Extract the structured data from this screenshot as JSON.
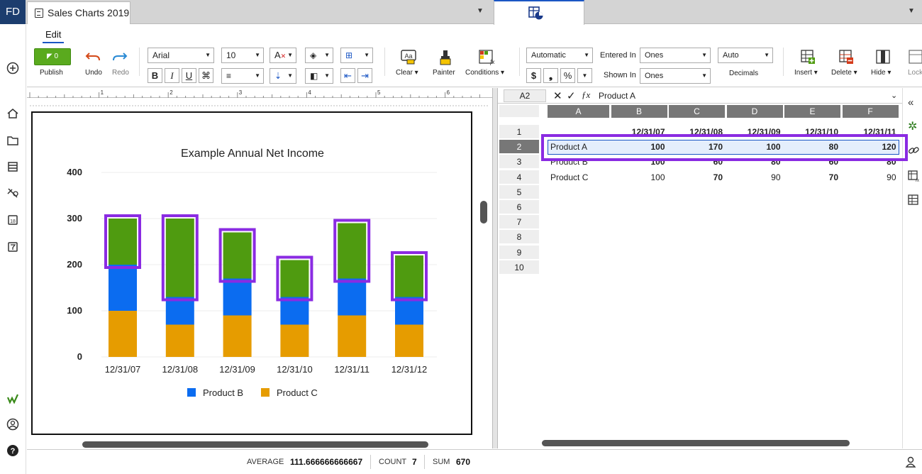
{
  "app": {
    "logo": "FD",
    "doc_tab": "Sales Charts 2019"
  },
  "toolbar": {
    "edit_tab": "Edit",
    "publish": {
      "badge": "0",
      "label": "Publish"
    },
    "undo": "Undo",
    "redo": "Redo",
    "font_family": "Arial",
    "font_size": "10",
    "bold": "B",
    "italic": "I",
    "underline": "U",
    "clear": "Clear",
    "painter": "Painter",
    "conditions": "Conditions",
    "number_format": "Automatic",
    "currency": "$",
    "comma": ")",
    "percent": "%",
    "entered_in_label": "Entered In",
    "entered_in_value": "Ones",
    "shown_in_label": "Shown In",
    "shown_in_value": "Ones",
    "decimals_value": "Auto",
    "decimals_label": "Decimals",
    "insert": "Insert",
    "delete": "Delete",
    "hide": "Hide",
    "lock": "Lock"
  },
  "ruler": [
    "1",
    "2",
    "3",
    "4",
    "5",
    "6"
  ],
  "chart_data": {
    "type": "bar",
    "stacked": true,
    "title": "Example Annual Net Income",
    "categories": [
      "12/31/07",
      "12/31/08",
      "12/31/09",
      "12/31/10",
      "12/31/11",
      "12/31/12"
    ],
    "ylim": [
      0,
      400
    ],
    "yticks": [
      "0",
      "100",
      "200",
      "300",
      "400"
    ],
    "series": [
      {
        "name": "Product C",
        "color": "#e69c00",
        "values": [
          100,
          70,
          90,
          70,
          90,
          70
        ]
      },
      {
        "name": "Product B",
        "color": "#0b6cf0",
        "values": [
          100,
          60,
          80,
          60,
          80,
          60
        ]
      },
      {
        "name": "",
        "color": "#4f9b10",
        "values": [
          100,
          170,
          100,
          80,
          120,
          90
        ]
      }
    ],
    "legend": [
      "Product B",
      "Product C"
    ],
    "legend_placement": "bottom"
  },
  "formula": {
    "cell_ref": "A2",
    "content": "Product A"
  },
  "sheet": {
    "columns": [
      "A",
      "B",
      "C",
      "D",
      "E",
      "F"
    ],
    "rows": [
      "1",
      "2",
      "3",
      "4",
      "5",
      "6",
      "7",
      "8",
      "9",
      "10"
    ],
    "header_row": [
      "",
      "12/31/07",
      "12/31/08",
      "12/31/09",
      "12/31/10",
      "12/31/11"
    ],
    "data": [
      [
        "Product A",
        "100",
        "170",
        "100",
        "80",
        "120"
      ],
      [
        "Product B",
        "100",
        "60",
        "80",
        "60",
        "80"
      ],
      [
        "Product C",
        "100",
        "70",
        "90",
        "70",
        "90"
      ]
    ]
  },
  "status": {
    "average_label": "AVERAGE",
    "average_value": "111.666666666667",
    "count_label": "COUNT",
    "count_value": "7",
    "sum_label": "SUM",
    "sum_value": "670"
  }
}
